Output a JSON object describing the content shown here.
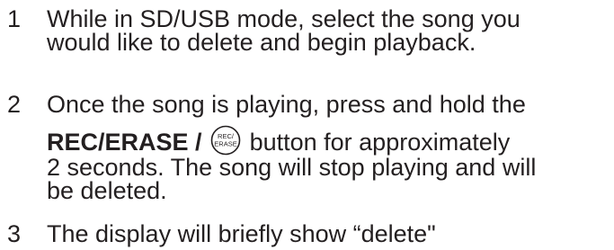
{
  "steps": [
    {
      "number": "1",
      "lines": [
        "While in SD/USB mode, select the song you",
        "would like to delete and begin playback."
      ]
    },
    {
      "number": "2",
      "line1": "Once the song is playing, press and hold the",
      "button_label": "REC/ERASE /",
      "icon_text_top": "REC/",
      "icon_text_bottom": "ERASE",
      "line2_after": " button for approximately",
      "line3": "2 seconds. The song will stop playing and will",
      "line4": "be deleted."
    },
    {
      "number": "3",
      "line1": "The display will briefly show “delete\""
    }
  ]
}
